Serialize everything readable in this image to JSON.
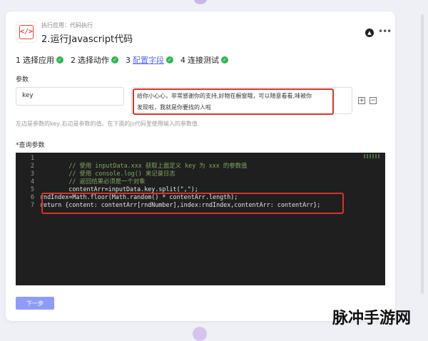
{
  "app": {
    "icon": "code-icon",
    "icon_glyph": "</>",
    "subtitle": "执行应用：代码执行",
    "title": "2.运行Javascript代码"
  },
  "header_actions": {
    "collapse_icon": "chevron-up-circle-icon",
    "more_icon": "more-dots-icon"
  },
  "steps": [
    {
      "number": "1",
      "label": "选择应用",
      "done": true
    },
    {
      "number": "2",
      "label": "选择动作",
      "done": true
    },
    {
      "number": "3",
      "label": "配置字段",
      "done": true,
      "active": true
    },
    {
      "number": "4",
      "label": "连接测试",
      "done": true
    }
  ],
  "params": {
    "section_label": "参数",
    "key_value": "key",
    "value_line1": "给你小心心，非常感谢你的支持,好物在橱窗哦，可以随意看看,味被你",
    "value_line2": "发现啦，我就是你要找的人啦",
    "hint": "左边是参数的key,右边是参数的值。在下面的js代码里使用输入的参数值"
  },
  "query": {
    "section_label": "*查询参数"
  },
  "code": {
    "lines": [
      {
        "n": "1",
        "text": "",
        "type": "code"
      },
      {
        "n": "2",
        "text": "        // 使用 inputData.xxx 获取上面定义 key 为 xxx 的参数值",
        "type": "comment"
      },
      {
        "n": "3",
        "text": "        // 使用 console.log() 来记录日志",
        "type": "comment"
      },
      {
        "n": "4",
        "text": "        // 返回结果必须是一个对象",
        "type": "comment"
      },
      {
        "n": "5",
        "text": "        contentArr=inputData.key.split(\",\");",
        "type": "code"
      },
      {
        "n": "6",
        "text": "rndIndex=Math.floor(Math.random() * contentArr.length);",
        "type": "code"
      },
      {
        "n": "7",
        "text": "return {content: contentArr[rndNumber],index:rndIndex,contentArr: contentArr};",
        "type": "code"
      }
    ]
  },
  "footer": {
    "next_label": "下一步"
  },
  "watermark": "脉冲手游网",
  "colors": {
    "accent": "#5b6cf0",
    "success": "#2fb552",
    "highlight": "#d8342a",
    "code_bg": "#1f1f1f",
    "comment": "#7ea660",
    "button": "#8e9cf7"
  }
}
